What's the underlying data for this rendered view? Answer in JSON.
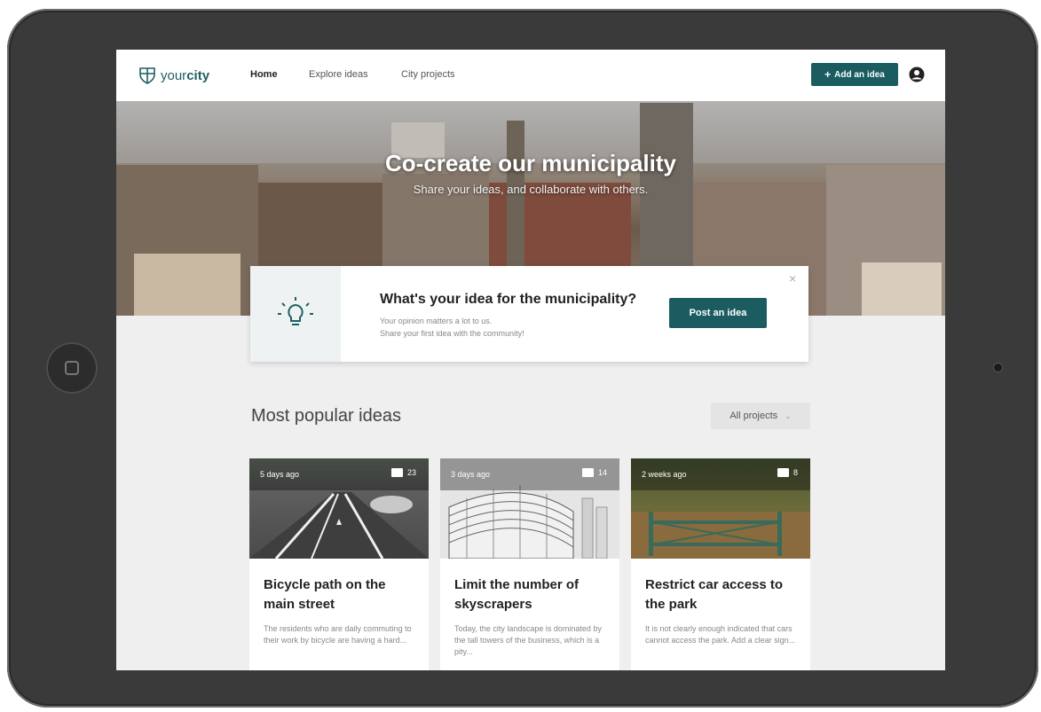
{
  "brand": {
    "logo_light": "your",
    "logo_bold": "city"
  },
  "nav": {
    "items": [
      {
        "label": "Home",
        "active": true
      },
      {
        "label": "Explore ideas",
        "active": false
      },
      {
        "label": "City projects",
        "active": false
      }
    ],
    "add_label": "Add an idea"
  },
  "hero": {
    "title": "Co-create our municipality",
    "subtitle": "Share your ideas, and collaborate with others."
  },
  "callout": {
    "title": "What's your idea for the municipality?",
    "line1": "Your opinion matters a lot to us.",
    "line2": "Share your first idea with the community!",
    "button": "Post an idea",
    "close": "×"
  },
  "section": {
    "title": "Most popular ideas",
    "filter": "All projects"
  },
  "cards": [
    {
      "time": "5 days ago",
      "comments": "23",
      "title": "Bicycle path on the main street",
      "desc": "The residents who are daily commuting to their work by bicycle are having a hard..."
    },
    {
      "time": "3 days ago",
      "comments": "14",
      "title": "Limit the number of skyscrapers",
      "desc": "Today, the city landscape is dominated by the tall towers of the business, which is a pity..."
    },
    {
      "time": "2 weeks ago",
      "comments": "8",
      "title": "Restrict car access to the park",
      "desc": "It is not clearly enough indicated that cars cannot access the park. Add a clear sign..."
    }
  ],
  "colors": {
    "accent": "#1a5c60"
  }
}
